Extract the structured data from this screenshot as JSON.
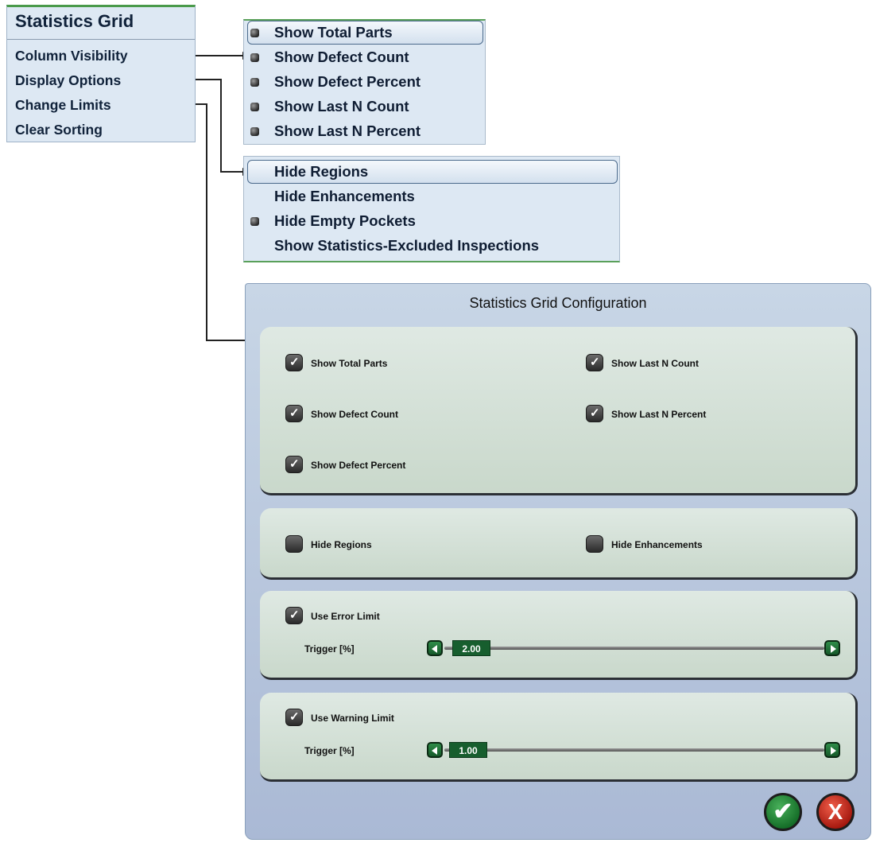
{
  "context_menu": {
    "title": "Statistics Grid",
    "items": [
      "Column Visibility",
      "Display Options",
      "Change Limits",
      "Clear Sorting"
    ]
  },
  "column_visibility_menu": {
    "items": [
      {
        "label": "Show Total Parts",
        "checked": true,
        "highlighted": true
      },
      {
        "label": "Show Defect Count",
        "checked": true
      },
      {
        "label": "Show Defect Percent",
        "checked": true
      },
      {
        "label": "Show Last N Count",
        "checked": true
      },
      {
        "label": "Show Last N Percent",
        "checked": true
      }
    ]
  },
  "display_options_menu": {
    "items": [
      {
        "label": "Hide Regions",
        "checked": false,
        "highlighted": true
      },
      {
        "label": "Hide Enhancements",
        "checked": false
      },
      {
        "label": "Hide Empty Pockets",
        "checked": true
      },
      {
        "label": "Show Statistics-Excluded Inspections",
        "checked": false
      }
    ]
  },
  "dialog": {
    "title": "Statistics Grid Configuration",
    "columns_panel": {
      "show_total_parts": "Show Total Parts",
      "show_defect_count": "Show Defect Count",
      "show_defect_percent": "Show Defect Percent",
      "show_last_n_count": "Show Last N Count",
      "show_last_n_percent": "Show Last N Percent"
    },
    "display_panel": {
      "hide_regions": "Hide Regions",
      "hide_enhancements": "Hide Enhancements"
    },
    "error_panel": {
      "checkbox_label": "Use Error Limit",
      "trigger_label": "Trigger [%]",
      "value": "2.00"
    },
    "warning_panel": {
      "checkbox_label": "Use Warning Limit",
      "trigger_label": "Trigger [%]",
      "value": "1.00"
    },
    "ok_glyph": "✔",
    "cancel_glyph": "X"
  },
  "colors": {
    "menu_bg": "#dde8f3",
    "panel_bg": "#d3e1d6",
    "slider_green": "#175e2e",
    "ok_green": "#2f8d3f",
    "cancel_red": "#c9261a"
  }
}
